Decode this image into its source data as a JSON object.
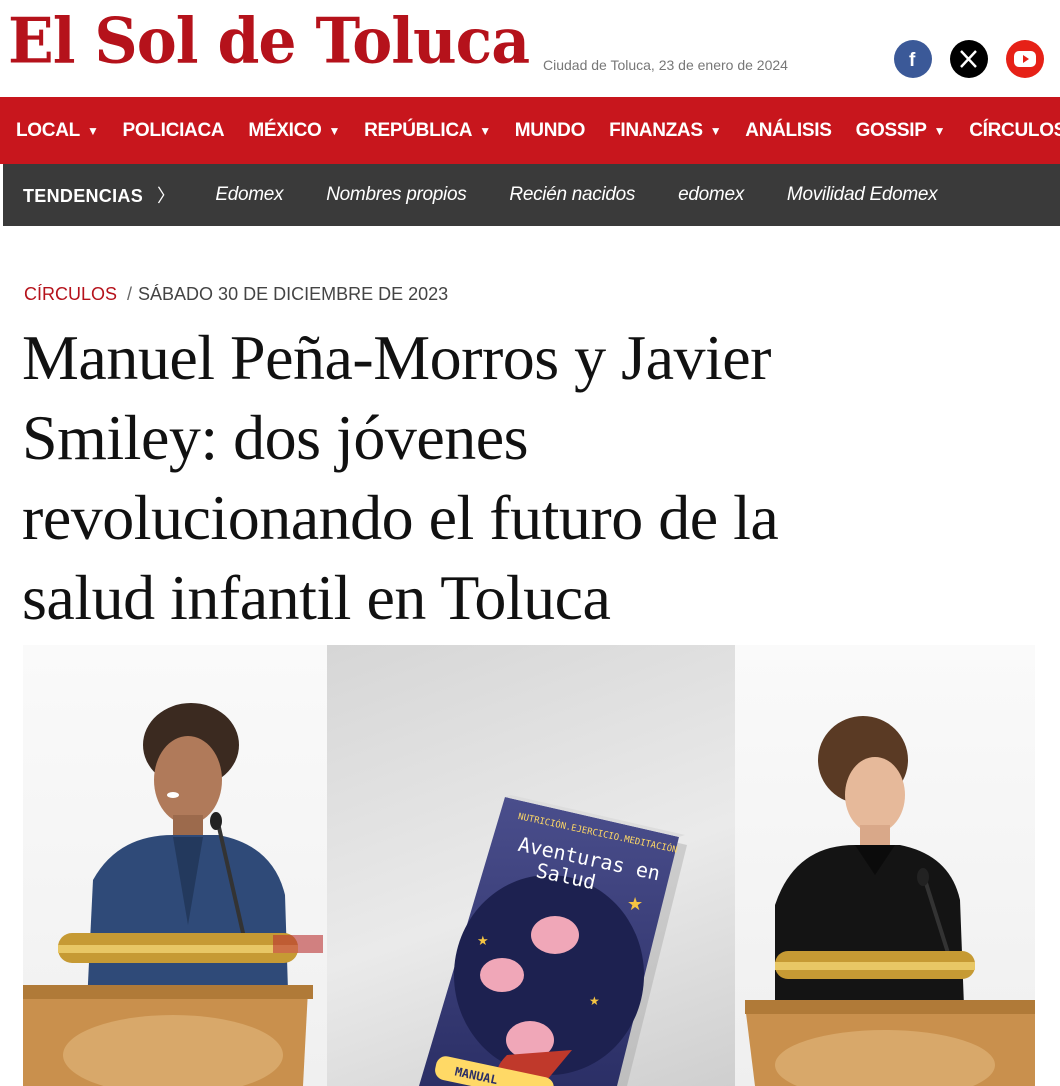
{
  "site": {
    "logo_text": "El Sol de Toluca",
    "dateline": "Ciudad de Toluca, 23 de enero de 2024",
    "brand_color": "#c8161d"
  },
  "socials": [
    {
      "name": "facebook",
      "icon": "facebook-icon",
      "color": "#3b5998"
    },
    {
      "name": "x",
      "icon": "x-icon",
      "color": "#000000"
    },
    {
      "name": "youtube",
      "icon": "youtube-icon",
      "color": "#e62117"
    }
  ],
  "main_nav": [
    {
      "label": "LOCAL",
      "dropdown": true
    },
    {
      "label": "POLICIACA",
      "dropdown": false
    },
    {
      "label": "MÉXICO",
      "dropdown": true
    },
    {
      "label": "REPÚBLICA",
      "dropdown": true
    },
    {
      "label": "MUNDO",
      "dropdown": false
    },
    {
      "label": "FINANZAS",
      "dropdown": true
    },
    {
      "label": "ANÁLISIS",
      "dropdown": false
    },
    {
      "label": "GOSSIP",
      "dropdown": true
    },
    {
      "label": "CÍRCULOS",
      "dropdown": false
    }
  ],
  "trends": {
    "label": "TENDENCIAS",
    "chevron": "〉",
    "items": [
      "Edomex",
      "Nombres propios",
      "Recién nacidos",
      "edomex",
      "Movilidad Edomex"
    ]
  },
  "article": {
    "section": "CÍRCULOS",
    "separator": "/",
    "date": "SÁBADO 30 DE DICIEMBRE DE 2023",
    "headline": "Manuel Peña-Morros y Javier Smiley: dos jóvenes revolucionando el futuro de la salud infantil en Toluca"
  },
  "hero_image": {
    "book_subtitle": "NUTRICIÓN.EJERCICIO.MEDITACIÓN",
    "book_title": "Aventuras en Salud",
    "book_footer": "MANUAL"
  }
}
